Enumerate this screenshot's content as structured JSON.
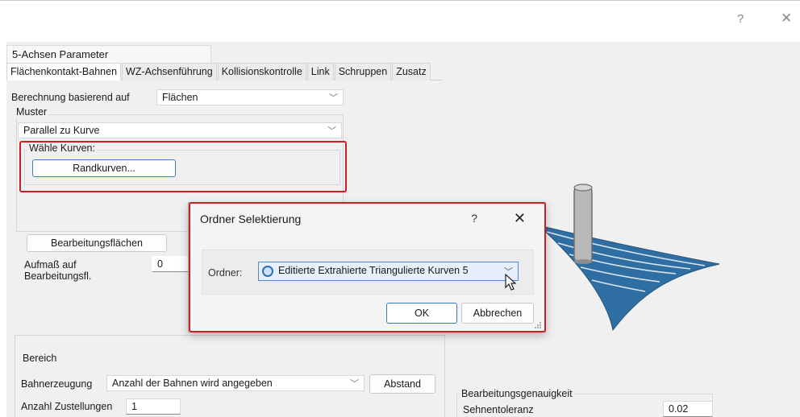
{
  "window": {
    "help_label": "?",
    "close_label": "✕"
  },
  "group_tab": "5-Achsen Parameter",
  "tabs": [
    {
      "label": "Flächenkontakt-Bahnen",
      "active": true
    },
    {
      "label": "WZ-Achsenführung",
      "active": false
    },
    {
      "label": "Kollisionskontrolle",
      "active": false
    },
    {
      "label": "Link",
      "active": false
    },
    {
      "label": "Schruppen",
      "active": false
    },
    {
      "label": "Zusatz",
      "active": false
    }
  ],
  "form": {
    "berechnung_label": "Berechnung basierend auf",
    "berechnung_value": "Flächen",
    "muster_title": "Muster",
    "muster_value": "Parallel zu Kurve",
    "waehle_kurven_title": "Wähle Kurven:",
    "randkurven_button": "Randkurven...",
    "bearbeitungsflaechen_button": "Bearbeitungsflächen",
    "aufmass_label_1": "Aufmaß auf",
    "aufmass_label_2": "Bearbeitungsfl.",
    "aufmass_value": "0",
    "bereich_title": "Bereich",
    "bahnerzeugung_label": "Bahnerzeugung",
    "bahnerzeugung_value": "Anzahl der Bahnen wird angegeben",
    "abstand_button": "Abstand",
    "zustellungen_label": "Anzahl Zustellungen",
    "zustellungen_value": "1",
    "genauigkeit_title": "Bearbeitungsgenauigkeit",
    "sehnentoleranz_label": "Sehnentoleranz",
    "sehnentoleranz_value": "0.02"
  },
  "dialog": {
    "title": "Ordner Selektierung",
    "help_label": "?",
    "close_label": "✕",
    "ordner_label": "Ordner:",
    "ordner_value": "Editierte Extrahierte Triangulierte Kurven 5",
    "ok_button": "OK",
    "cancel_button": "Abbrechen"
  },
  "colors": {
    "highlight_red": "#cc1f1f",
    "selection_blue": "#4f8ad2",
    "surface_blue": "#2f6ea3"
  },
  "icons": [
    "chevron-down-icon",
    "folder-icon",
    "mouse-cursor-icon",
    "resize-grip-icon",
    "close-icon",
    "help-icon"
  ]
}
